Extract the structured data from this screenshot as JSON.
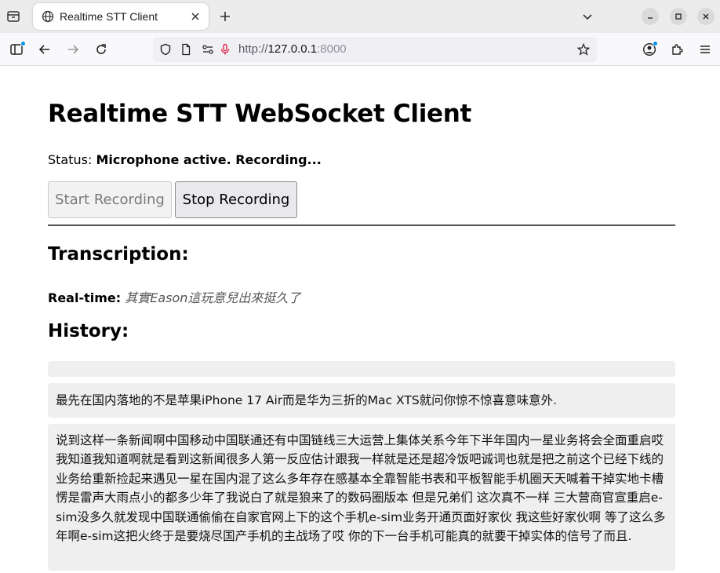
{
  "browser": {
    "tab_title": "Realtime STT Client",
    "url_scheme": "http://",
    "url_host": "127.0.0.1",
    "url_port": ":8000"
  },
  "page": {
    "title": "Realtime STT WebSocket Client",
    "status_label": "Status:",
    "status_text": "Microphone active. Recording...",
    "start_button": "Start Recording",
    "stop_button": "Stop Recording",
    "transcription_heading": "Transcription:",
    "realtime_label": "Real-time:",
    "realtime_text": "其實Eason這玩意兒出來挺久了",
    "history_heading": "History:",
    "history": [
      "",
      "最先在国内落地的不是苹果iPhone 17 Air而是华为三折的Mac XTS就问你惊不惊喜意味意外.",
      "说到这样一条新闻啊中国移动中国联通还有中国链线三大运营上集体关系今年下半年国内一星业务将会全面重启哎我知道我知道啊就是看到这新闻很多人第一反应估计跟我一样就是还是超冷饭吧诚词也就是把之前这个已经下线的业务给重新捡起来遇见一星在国内混了这么多年存在感基本全靠智能书表和平板智能手机圈天天喊着干掉实地卡槽愣是雷声大雨点小的都多少年了我说白了就是狼来了的数码圈版本 但是兄弟们 这次真不一样 三大营商官宣重启e-sim没多久就发现中国联通偷偷在自家官网上下的这个手机e-sim业务开通页面好家伙 我这些好家伙啊 等了这么多年啊e-sim这把火终于是要烧尽国产手机的主战场了哎 你的下一台手机可能真的就要干掉实体的信号了而且."
    ]
  }
}
